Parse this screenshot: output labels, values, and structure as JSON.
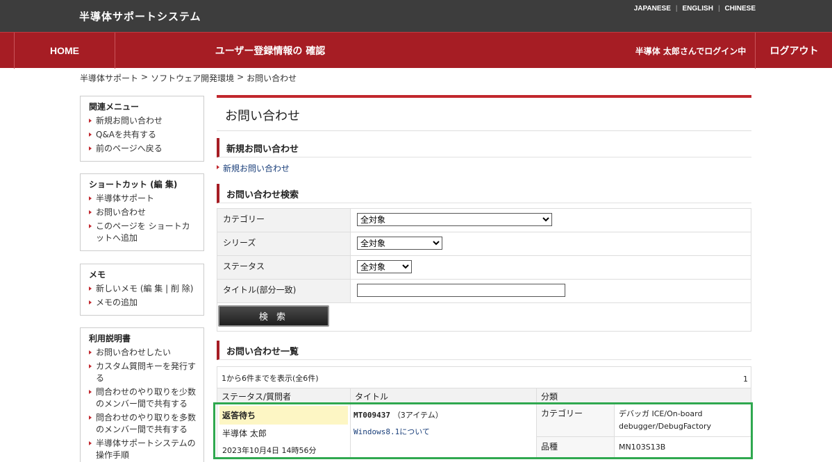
{
  "header": {
    "site_title": "半導体サポートシステム",
    "languages": [
      "JAPANESE",
      "ENGLISH",
      "CHINESE"
    ]
  },
  "nav": {
    "home": "HOME",
    "confirm": "ユーザー登録情報の 確認",
    "user": "半導体 太郎さんでログイン中",
    "logout": "ログアウト"
  },
  "breadcrumb": [
    "半導体サポート",
    "ソフトウェア開発環境",
    "お問い合わせ"
  ],
  "sidebar": {
    "related": {
      "title": "関連メニュー",
      "items": [
        "新規お問い合わせ",
        "Q&Aを共有する",
        "前のページへ戻る"
      ]
    },
    "shortcut": {
      "title": "ショートカット (編 集)",
      "items": [
        "半導体サポート",
        "お問い合わせ",
        "このページを ショートカットへ追加"
      ]
    },
    "memo": {
      "title": "メモ",
      "items": [
        "新しいメモ (編 集 | 削 除)",
        "メモの追加"
      ]
    },
    "manual": {
      "title": "利用説明書",
      "items": [
        "お問い合わせしたい",
        "カスタム質問キーを発行する",
        "問合わせのやり取りを少数のメンバー間で共有する",
        "問合わせのやり取りを多数のメンバー間で共有する",
        "半導体サポートシステムの操作手順"
      ]
    }
  },
  "main": {
    "page_title": "お問い合わせ",
    "new_section": "新規お問い合わせ",
    "new_link": "新規お問い合わせ",
    "search_section": "お問い合わせ検索",
    "search": {
      "category_label": "カテゴリー",
      "category_value": "全対象",
      "series_label": "シリーズ",
      "series_value": "全対象",
      "status_label": "ステータス",
      "status_value": "全対象",
      "title_label": "タイトル(部分一致)",
      "title_value": "",
      "button": "検 索"
    },
    "list_section": "お問い合わせ一覧",
    "list": {
      "count_text": "1から6件までを表示(全6件)",
      "page": "1",
      "headers": [
        "ステータス/質問者",
        "タイトル",
        "分類"
      ],
      "row": {
        "status": "返答待ち",
        "asker": "半導体 太郎",
        "date": "2023年10月4日 14時56分",
        "ticket": "MT009437",
        "items": "（3アイテム）",
        "title": "Windows8.1について",
        "category_label": "カテゴリー",
        "category_value": "デバッガ ICE/On-board debugger/DebugFactory",
        "product_label": "品種",
        "product_value": "MN103S13B"
      }
    }
  },
  "colors": {
    "topbar": "#3d3d3d",
    "nav_red": "#a61d24",
    "accent_red": "#c1272d",
    "highlight_green": "#2fa84f",
    "status_yellow": "#fdf6c4"
  }
}
